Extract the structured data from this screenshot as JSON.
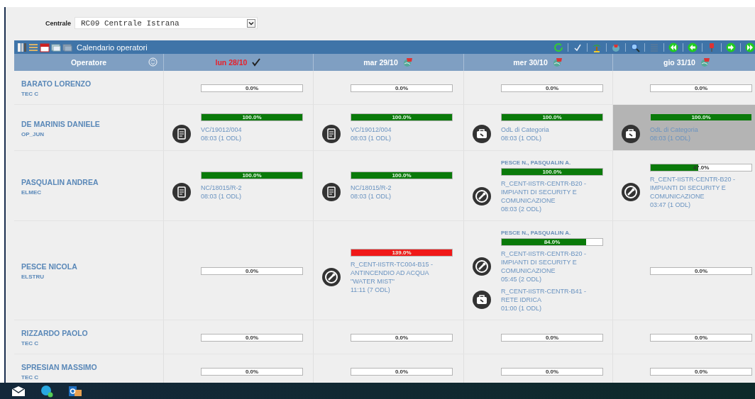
{
  "filter": {
    "label": "Centrale",
    "value": "RC09 Centrale Istrana"
  },
  "panel": {
    "title": "Calendario operatori"
  },
  "columns": {
    "operator": "Operatore",
    "days": [
      {
        "label": "lun 28/10",
        "today": true
      },
      {
        "label": "mar 29/10",
        "today": false
      },
      {
        "label": "mer 30/10",
        "today": false
      },
      {
        "label": "gio 31/10",
        "today": false
      }
    ]
  },
  "operators": [
    {
      "name": "BARATO LORENZO",
      "role": "TEC C",
      "days": [
        {
          "highlighted": false,
          "bar": {
            "label": "0.0%"
          }
        },
        {
          "highlighted": false,
          "bar": {
            "label": "0.0%"
          }
        },
        {
          "highlighted": false,
          "bar": {
            "label": "0.0%"
          }
        },
        {
          "highlighted": false,
          "bar": {
            "label": "0.0%"
          }
        }
      ]
    },
    {
      "name": "DE MARINIS DANIELE",
      "role": "OP_JUN",
      "days": [
        {
          "highlighted": false,
          "bar": {
            "level": 1,
            "label": "100.0%",
            "over": false
          },
          "items": [
            {
              "kind": "document",
              "title": "VC/19012/004",
              "time": "08:03 (1 ODL)"
            }
          ]
        },
        {
          "highlighted": false,
          "bar": {
            "level": 1,
            "label": "100.0%",
            "over": false
          },
          "items": [
            {
              "kind": "document",
              "title": "VC/19012/004",
              "time": "08:03 (1 ODL)"
            }
          ]
        },
        {
          "highlighted": false,
          "bar": {
            "level": 1,
            "label": "100.0%",
            "over": false
          },
          "items": [
            {
              "kind": "toolbox",
              "title": "OdL di Categoria",
              "time": "08:03 (1 ODL)"
            }
          ]
        },
        {
          "highlighted": true,
          "bar": {
            "level": 1,
            "label": "100.0%",
            "over": false
          },
          "items": [
            {
              "kind": "toolbox",
              "title": "OdL di Categoria",
              "time": "08:03 (1 ODL)"
            }
          ]
        }
      ]
    },
    {
      "name": "PASQUALIN ANDREA",
      "role": "ELMEC",
      "days": [
        {
          "highlighted": false,
          "bar": {
            "level": 1,
            "label": "100.0%",
            "over": false
          },
          "items": [
            {
              "kind": "document",
              "title": "NC/18015/R-2",
              "time": "08:03 (1 ODL)"
            }
          ]
        },
        {
          "highlighted": false,
          "bar": {
            "level": 1,
            "label": "100.0%",
            "over": false
          },
          "items": [
            {
              "kind": "document",
              "title": "NC/18015/R-2",
              "time": "08:03 (1 ODL)"
            }
          ]
        },
        {
          "highlighted": false,
          "assignees": "PESCE N., PASQUALIN A.",
          "bar": {
            "level": 1,
            "label": "100.0%",
            "over": false
          },
          "items": [
            {
              "kind": "maintenance",
              "title": "R_CENT-IISTR-CENTR-B20 - IMPIANTI DI SECURITY E COMUNICAZIONE",
              "time": "08:03 (2 ODL)"
            }
          ]
        },
        {
          "highlighted": false,
          "bar": {
            "level": 0.47,
            "label": "47.0%",
            "over": false
          },
          "items": [
            {
              "kind": "maintenance",
              "title": "R_CENT-IISTR-CENTR-B20 - IMPIANTI DI SECURITY E COMUNICAZIONE",
              "time": "03:47 (1 ODL)"
            }
          ]
        }
      ]
    },
    {
      "name": "PESCE NICOLA",
      "role": "ELSTRU",
      "days": [
        {
          "highlighted": false,
          "bar": {
            "label": "0.0%"
          }
        },
        {
          "highlighted": false,
          "bar": {
            "level": 1,
            "label": "139.0%",
            "over": true
          },
          "items": [
            {
              "kind": "maintenance",
              "title": "R_CENT-IISTR-TC004-B15 - ANTINCENDIO AD ACQUA \"WATER MIST\"",
              "time": "11:11 (7 ODL)"
            }
          ]
        },
        {
          "highlighted": false,
          "assignees": "PESCE N., PASQUALIN A.",
          "bar": {
            "level": 0.84,
            "label": "84.0%",
            "over": false
          },
          "items": [
            {
              "kind": "maintenance",
              "title": "R_CENT-IISTR-CENTR-B20 - IMPIANTI DI SECURITY E COMUNICAZIONE",
              "time": "05:45 (2 ODL)"
            },
            {
              "kind": "toolbox",
              "title": "R_CENT-IISTR-CENTR-B41 - RETE IDRICA",
              "time": "01:00 (1 ODL)"
            }
          ]
        },
        {
          "highlighted": false,
          "bar": {
            "label": "0.0%"
          }
        }
      ]
    },
    {
      "name": "RIZZARDO PAOLO",
      "role": "TEC C",
      "days": [
        {
          "highlighted": false,
          "bar": {
            "label": "0.0%"
          }
        },
        {
          "highlighted": false,
          "bar": {
            "label": "0.0%"
          }
        },
        {
          "highlighted": false,
          "bar": {
            "label": "0.0%"
          }
        },
        {
          "highlighted": false,
          "bar": {
            "label": "0.0%"
          }
        }
      ]
    },
    {
      "name": "SPRESIAN MASSIMO",
      "role": "TEC C",
      "days": [
        {
          "highlighted": false,
          "bar": {
            "label": "0.0%"
          }
        },
        {
          "highlighted": false,
          "bar": {
            "label": "0.0%"
          }
        },
        {
          "highlighted": false,
          "bar": {
            "label": "0.0%"
          }
        },
        {
          "highlighted": false,
          "bar": {
            "label": "0.0%"
          }
        }
      ]
    }
  ]
}
